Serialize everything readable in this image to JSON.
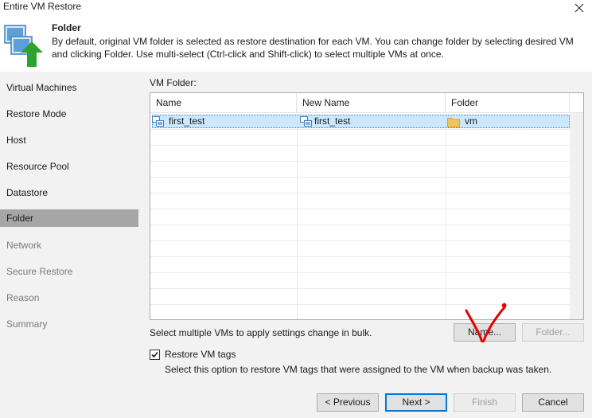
{
  "window": {
    "title": "Entire VM Restore"
  },
  "header": {
    "title": "Folder",
    "description": "By default, original VM folder is selected as restore destination for each VM. You can change folder by selecting desired VM and clicking Folder. Use multi-select (Ctrl-click and Shift-click) to select multiple VMs at once."
  },
  "sidebar": {
    "items": [
      {
        "label": "Virtual Machines",
        "state": "enabled"
      },
      {
        "label": "Restore Mode",
        "state": "enabled"
      },
      {
        "label": "Host",
        "state": "enabled"
      },
      {
        "label": "Resource Pool",
        "state": "enabled"
      },
      {
        "label": "Datastore",
        "state": "enabled"
      },
      {
        "label": "Folder",
        "state": "active"
      },
      {
        "label": "Network",
        "state": "disabled"
      },
      {
        "label": "Secure Restore",
        "state": "disabled"
      },
      {
        "label": "Reason",
        "state": "disabled"
      },
      {
        "label": "Summary",
        "state": "disabled"
      }
    ]
  },
  "main": {
    "vm_folder_label": "VM Folder:",
    "table": {
      "columns": [
        "Name",
        "New Name",
        "Folder"
      ],
      "rows": [
        {
          "name": "first_test",
          "new_name": "first_test",
          "folder": "vm",
          "selected": true
        }
      ]
    },
    "bulk_hint": "Select multiple VMs to apply settings change in bulk.",
    "name_button": "Name...",
    "folder_button": "Folder...",
    "restore_tags": {
      "checked": true,
      "label": "Restore VM tags",
      "description": "Select this option to restore VM tags that were assigned to the VM when backup was taken."
    }
  },
  "footer": {
    "previous": "< Previous",
    "next": "Next >",
    "finish": "Finish",
    "cancel": "Cancel"
  },
  "colors": {
    "sidebar_bg": "#f2f2f2",
    "active_item_bg": "#a6a6a6",
    "selected_row_bg": "#cce8ff",
    "annotation_red": "#e60000"
  }
}
